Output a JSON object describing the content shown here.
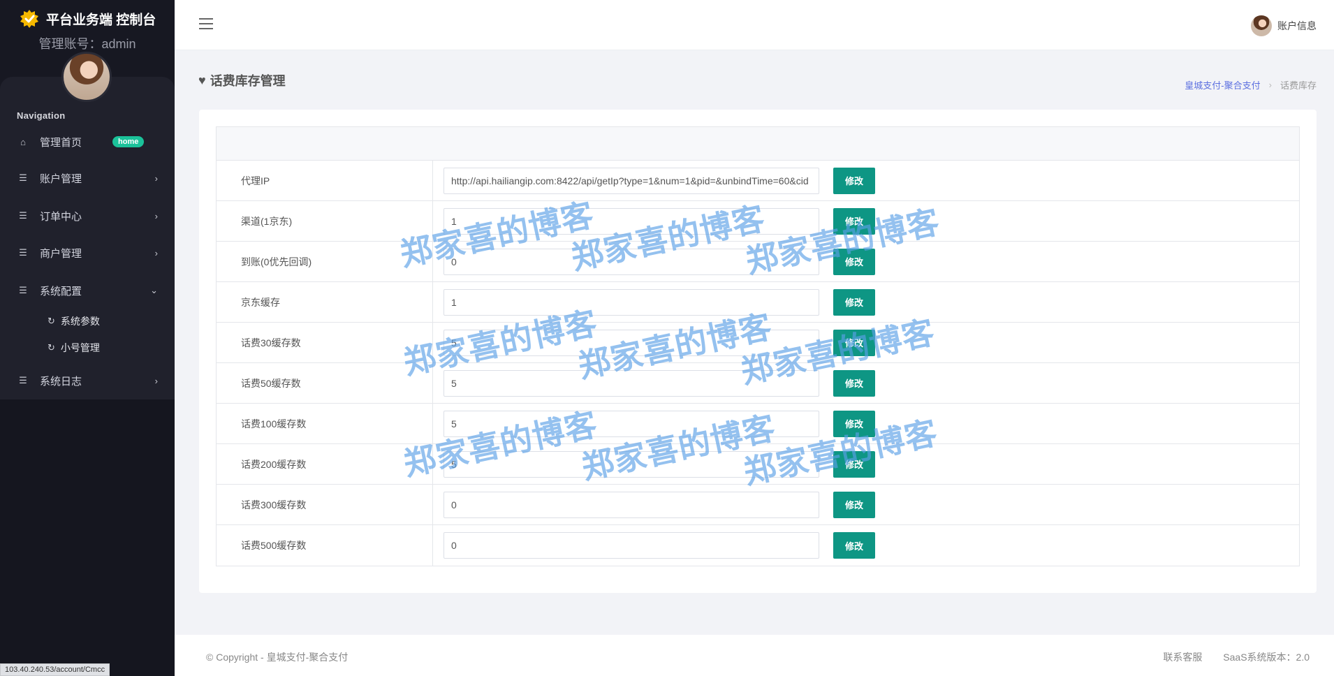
{
  "sidebar": {
    "brand": "平台业务端 控制台",
    "admin_line": "管理账号：admin",
    "nav_title": "Navigation",
    "items": [
      {
        "label": "管理首页",
        "badge": "home"
      },
      {
        "label": "账户管理"
      },
      {
        "label": "订单中心"
      },
      {
        "label": "商户管理"
      },
      {
        "label": "系统配置"
      },
      {
        "label": "系统日志"
      }
    ],
    "sub_items": [
      {
        "label": "系统参数"
      },
      {
        "label": "小号管理"
      }
    ],
    "status_url": "103.40.240.53/account/Cmcc"
  },
  "header": {
    "account_label": "账户信息"
  },
  "page": {
    "title": "话费库存管理",
    "breadcrumb": {
      "root": "皇城支付-聚合支付",
      "current": "话费库存"
    }
  },
  "form": {
    "button_label": "修改",
    "rows": [
      {
        "label": "代理IP",
        "value": "http://api.hailiangip.com:8422/api/getIp?type=1&num=1&pid=&unbindTime=60&cid"
      },
      {
        "label": "渠道(1京东)",
        "value": "1"
      },
      {
        "label": "到账(0优先回调)",
        "value": "0"
      },
      {
        "label": "京东缓存",
        "value": "1"
      },
      {
        "label": "话费30缓存数",
        "value": "5"
      },
      {
        "label": "话费50缓存数",
        "value": "5"
      },
      {
        "label": "话费100缓存数",
        "value": "5"
      },
      {
        "label": "话费200缓存数",
        "value": "5"
      },
      {
        "label": "话费300缓存数",
        "value": "0"
      },
      {
        "label": "话费500缓存数",
        "value": "0"
      }
    ]
  },
  "footer": {
    "copyright": "© Copyright - 皇城支付-聚合支付",
    "support": "联系客服",
    "version": "SaaS系统版本：2.0"
  },
  "watermark": "郑家喜的博客",
  "colors": {
    "primary_button": "#0e9684",
    "badge": "#1bc29a",
    "link": "#5b6fe0",
    "sidebar": "#15161f"
  }
}
